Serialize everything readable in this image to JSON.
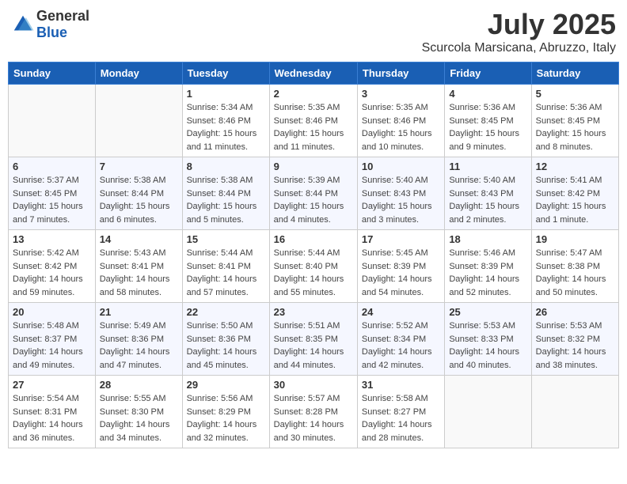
{
  "header": {
    "logo_general": "General",
    "logo_blue": "Blue",
    "month_title": "July 2025",
    "location": "Scurcola Marsicana, Abruzzo, Italy"
  },
  "days_of_week": [
    "Sunday",
    "Monday",
    "Tuesday",
    "Wednesday",
    "Thursday",
    "Friday",
    "Saturday"
  ],
  "weeks": [
    [
      {
        "day": "",
        "info": ""
      },
      {
        "day": "",
        "info": ""
      },
      {
        "day": "1",
        "info": "Sunrise: 5:34 AM\nSunset: 8:46 PM\nDaylight: 15 hours and 11 minutes."
      },
      {
        "day": "2",
        "info": "Sunrise: 5:35 AM\nSunset: 8:46 PM\nDaylight: 15 hours and 11 minutes."
      },
      {
        "day": "3",
        "info": "Sunrise: 5:35 AM\nSunset: 8:46 PM\nDaylight: 15 hours and 10 minutes."
      },
      {
        "day": "4",
        "info": "Sunrise: 5:36 AM\nSunset: 8:45 PM\nDaylight: 15 hours and 9 minutes."
      },
      {
        "day": "5",
        "info": "Sunrise: 5:36 AM\nSunset: 8:45 PM\nDaylight: 15 hours and 8 minutes."
      }
    ],
    [
      {
        "day": "6",
        "info": "Sunrise: 5:37 AM\nSunset: 8:45 PM\nDaylight: 15 hours and 7 minutes."
      },
      {
        "day": "7",
        "info": "Sunrise: 5:38 AM\nSunset: 8:44 PM\nDaylight: 15 hours and 6 minutes."
      },
      {
        "day": "8",
        "info": "Sunrise: 5:38 AM\nSunset: 8:44 PM\nDaylight: 15 hours and 5 minutes."
      },
      {
        "day": "9",
        "info": "Sunrise: 5:39 AM\nSunset: 8:44 PM\nDaylight: 15 hours and 4 minutes."
      },
      {
        "day": "10",
        "info": "Sunrise: 5:40 AM\nSunset: 8:43 PM\nDaylight: 15 hours and 3 minutes."
      },
      {
        "day": "11",
        "info": "Sunrise: 5:40 AM\nSunset: 8:43 PM\nDaylight: 15 hours and 2 minutes."
      },
      {
        "day": "12",
        "info": "Sunrise: 5:41 AM\nSunset: 8:42 PM\nDaylight: 15 hours and 1 minute."
      }
    ],
    [
      {
        "day": "13",
        "info": "Sunrise: 5:42 AM\nSunset: 8:42 PM\nDaylight: 14 hours and 59 minutes."
      },
      {
        "day": "14",
        "info": "Sunrise: 5:43 AM\nSunset: 8:41 PM\nDaylight: 14 hours and 58 minutes."
      },
      {
        "day": "15",
        "info": "Sunrise: 5:44 AM\nSunset: 8:41 PM\nDaylight: 14 hours and 57 minutes."
      },
      {
        "day": "16",
        "info": "Sunrise: 5:44 AM\nSunset: 8:40 PM\nDaylight: 14 hours and 55 minutes."
      },
      {
        "day": "17",
        "info": "Sunrise: 5:45 AM\nSunset: 8:39 PM\nDaylight: 14 hours and 54 minutes."
      },
      {
        "day": "18",
        "info": "Sunrise: 5:46 AM\nSunset: 8:39 PM\nDaylight: 14 hours and 52 minutes."
      },
      {
        "day": "19",
        "info": "Sunrise: 5:47 AM\nSunset: 8:38 PM\nDaylight: 14 hours and 50 minutes."
      }
    ],
    [
      {
        "day": "20",
        "info": "Sunrise: 5:48 AM\nSunset: 8:37 PM\nDaylight: 14 hours and 49 minutes."
      },
      {
        "day": "21",
        "info": "Sunrise: 5:49 AM\nSunset: 8:36 PM\nDaylight: 14 hours and 47 minutes."
      },
      {
        "day": "22",
        "info": "Sunrise: 5:50 AM\nSunset: 8:36 PM\nDaylight: 14 hours and 45 minutes."
      },
      {
        "day": "23",
        "info": "Sunrise: 5:51 AM\nSunset: 8:35 PM\nDaylight: 14 hours and 44 minutes."
      },
      {
        "day": "24",
        "info": "Sunrise: 5:52 AM\nSunset: 8:34 PM\nDaylight: 14 hours and 42 minutes."
      },
      {
        "day": "25",
        "info": "Sunrise: 5:53 AM\nSunset: 8:33 PM\nDaylight: 14 hours and 40 minutes."
      },
      {
        "day": "26",
        "info": "Sunrise: 5:53 AM\nSunset: 8:32 PM\nDaylight: 14 hours and 38 minutes."
      }
    ],
    [
      {
        "day": "27",
        "info": "Sunrise: 5:54 AM\nSunset: 8:31 PM\nDaylight: 14 hours and 36 minutes."
      },
      {
        "day": "28",
        "info": "Sunrise: 5:55 AM\nSunset: 8:30 PM\nDaylight: 14 hours and 34 minutes."
      },
      {
        "day": "29",
        "info": "Sunrise: 5:56 AM\nSunset: 8:29 PM\nDaylight: 14 hours and 32 minutes."
      },
      {
        "day": "30",
        "info": "Sunrise: 5:57 AM\nSunset: 8:28 PM\nDaylight: 14 hours and 30 minutes."
      },
      {
        "day": "31",
        "info": "Sunrise: 5:58 AM\nSunset: 8:27 PM\nDaylight: 14 hours and 28 minutes."
      },
      {
        "day": "",
        "info": ""
      },
      {
        "day": "",
        "info": ""
      }
    ]
  ]
}
